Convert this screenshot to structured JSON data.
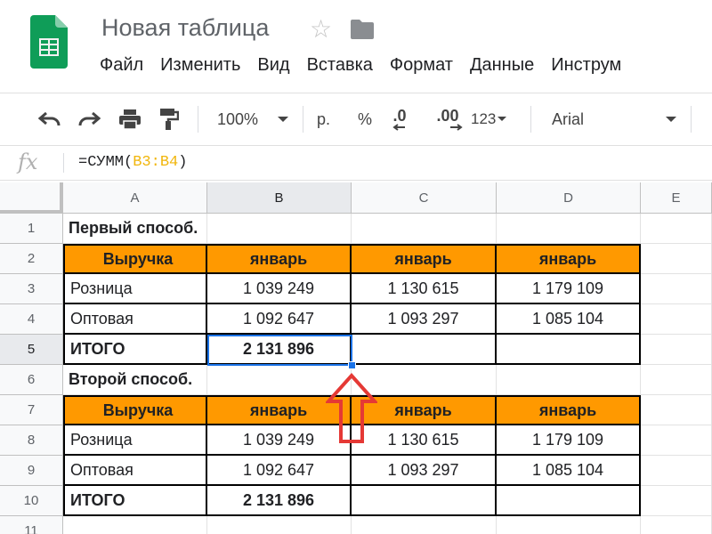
{
  "app": {
    "title": "Новая таблица",
    "menu": [
      "Файл",
      "Изменить",
      "Вид",
      "Вставка",
      "Формат",
      "Данные",
      "Инструм"
    ]
  },
  "toolbar": {
    "zoom": "100%",
    "currency": "р.",
    "percent": "%",
    "decrease_decimals": ".0",
    "increase_decimals": ".00",
    "more_formats": "123",
    "font": "Arial",
    "icons": [
      "undo-icon",
      "redo-icon",
      "print-icon",
      "paint-format-icon"
    ]
  },
  "formula_bar": {
    "fx": "fx",
    "prefix": "=СУММ(",
    "range": "B3:B4",
    "suffix": ")"
  },
  "columns": [
    "A",
    "B",
    "C",
    "D",
    "E"
  ],
  "rows": [
    "1",
    "2",
    "3",
    "4",
    "5",
    "6",
    "7",
    "8",
    "9",
    "10",
    "11"
  ],
  "cells": {
    "r1": {
      "A": "Первый способ."
    },
    "r2": {
      "A": "Выручка",
      "B": "январь",
      "C": "январь",
      "D": "январь"
    },
    "r3": {
      "A": "Розница",
      "B": "1 039 249",
      "C": "1 130 615",
      "D": "1 179 109"
    },
    "r4": {
      "A": "Оптовая",
      "B": "1 092 647",
      "C": "1 093 297",
      "D": "1 085 104"
    },
    "r5": {
      "A": "ИТОГО",
      "B": "2 131 896"
    },
    "r6": {
      "A": "Второй способ."
    },
    "r7": {
      "A": "Выручка",
      "B": "январь",
      "C": "январь",
      "D": "январь"
    },
    "r8": {
      "A": "Розница",
      "B": "1 039 249",
      "C": "1 130 615",
      "D": "1 179 109"
    },
    "r9": {
      "A": "Оптовая",
      "B": "1 092 647",
      "C": "1 093 297",
      "D": "1 085 104"
    },
    "r10": {
      "A": "ИТОГО",
      "B": "2 131 896"
    }
  },
  "selected_cell": "B5",
  "colors": {
    "header_fill": "#ff9900",
    "selection": "#1a73e8",
    "arrow": "#e53935",
    "sheets_green": "#0f9d58"
  }
}
